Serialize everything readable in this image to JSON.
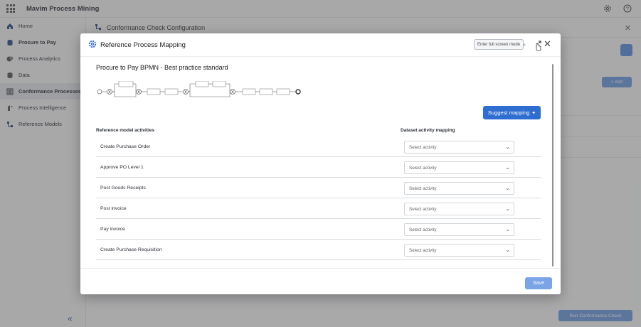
{
  "app": {
    "title": "Mavim Process Mining",
    "icons": [
      "apps-grid-icon",
      "gear-icon",
      "help-icon"
    ]
  },
  "sidebar": {
    "items": [
      {
        "label": "Home",
        "icon": "home-icon",
        "active": false
      },
      {
        "label": "Procure to Pay",
        "icon": "database-icon",
        "active": false
      },
      {
        "label": "Process Analytics",
        "icon": "analytics-icon",
        "active": false
      },
      {
        "label": "Data",
        "icon": "data-icon",
        "active": false
      },
      {
        "label": "Conformance Processes",
        "icon": "conformance-icon",
        "active": true
      },
      {
        "label": "Process Intelligence",
        "icon": "intelligence-icon",
        "active": false
      },
      {
        "label": "Reference Models",
        "icon": "reference-models-icon",
        "active": false
      }
    ],
    "collapse_icon": "double-chevron-left-icon"
  },
  "background": {
    "header_title": "Conformance Check Configuration",
    "add_label": "+ Add",
    "run_label": "Run Conformance Check"
  },
  "modal": {
    "title": "Reference Process Mapping",
    "fullscreen_tooltip": "Enter full screen mode",
    "model_title": "Procure to Pay BPMN - Best practice standard",
    "suggest_label": "Suggest mapping",
    "col_reference": "Reference model activities",
    "col_dataset": "Dataset activity mapping",
    "rows": [
      {
        "activity": "Create Purchase Order",
        "mapping": "Select activity"
      },
      {
        "activity": "Approve PO Level 1",
        "mapping": "Select activity"
      },
      {
        "activity": "Post Goods Receipts",
        "mapping": "Select activity"
      },
      {
        "activity": "Post invoice",
        "mapping": "Select activity"
      },
      {
        "activity": "Pay invoice",
        "mapping": "Select activity"
      },
      {
        "activity": "Create Purchase Requisition",
        "mapping": "Select activity"
      }
    ],
    "save_label": "Save"
  },
  "colors": {
    "primary": "#2f6ed1",
    "primary_disabled": "#7aa4e6",
    "sidebar_active": "#e5e8ee"
  }
}
